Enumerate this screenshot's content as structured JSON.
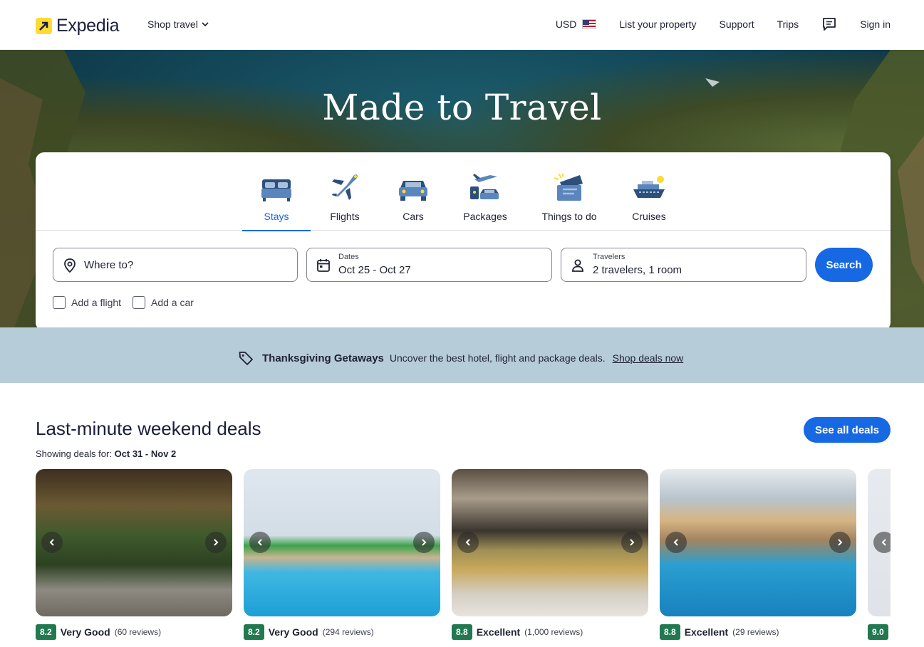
{
  "header": {
    "logo_text": "Expedia",
    "shop_travel": "Shop travel",
    "currency": "USD",
    "list_property": "List your property",
    "support": "Support",
    "trips": "Trips",
    "sign_in": "Sign in"
  },
  "hero": {
    "title": "Made to Travel"
  },
  "search": {
    "tabs": [
      {
        "label": "Stays",
        "icon": "bed-icon",
        "active": true
      },
      {
        "label": "Flights",
        "icon": "airplane-icon",
        "active": false
      },
      {
        "label": "Cars",
        "icon": "car-icon",
        "active": false
      },
      {
        "label": "Packages",
        "icon": "packages-icon",
        "active": false
      },
      {
        "label": "Things to do",
        "icon": "ticket-icon",
        "active": false
      },
      {
        "label": "Cruises",
        "icon": "cruise-ship-icon",
        "active": false
      }
    ],
    "destination_placeholder": "Where to?",
    "dates_label": "Dates",
    "dates_value": "Oct 25 - Oct 27",
    "travelers_label": "Travelers",
    "travelers_value": "2 travelers, 1 room",
    "search_button": "Search",
    "add_flight": "Add a flight",
    "add_car": "Add a car"
  },
  "banner": {
    "title": "Thanksgiving Getaways",
    "text": "Uncover the best hotel, flight and package deals.",
    "link": "Shop deals now"
  },
  "deals": {
    "title": "Last-minute weekend deals",
    "showing_for": "Showing deals for:",
    "date_range": "Oct 31 - Nov 2",
    "see_all": "See all deals",
    "cards": [
      {
        "score": "8.2",
        "label": "Very Good",
        "reviews": "(60 reviews)"
      },
      {
        "score": "8.2",
        "label": "Very Good",
        "reviews": "(294 reviews)"
      },
      {
        "score": "8.8",
        "label": "Excellent",
        "reviews": "(1,000 reviews)"
      },
      {
        "score": "8.8",
        "label": "Excellent",
        "reviews": "(29 reviews)"
      },
      {
        "score": "9.0",
        "label": "",
        "reviews": ""
      }
    ]
  },
  "colors": {
    "brand_blue": "#1668e3",
    "logo_yellow": "#fddb32",
    "rating_green": "#227950",
    "banner_bg": "#b7ccd9"
  }
}
